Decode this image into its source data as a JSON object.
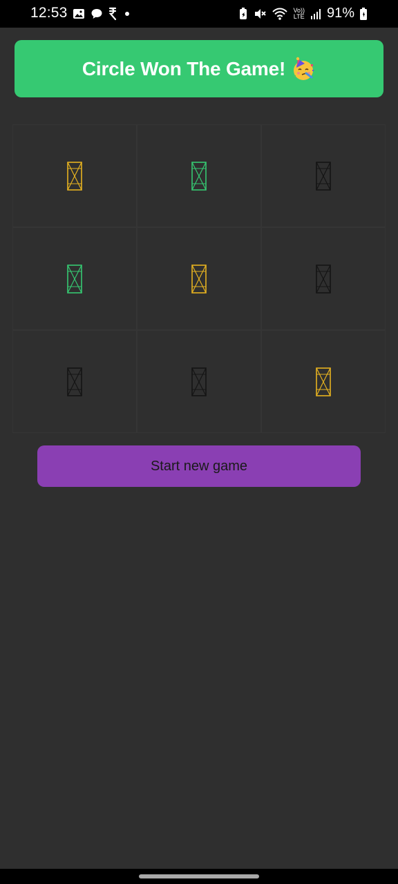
{
  "status_bar": {
    "time": "12:53",
    "battery_percent": "91%",
    "network_label_top": "Vo))",
    "network_label_bottom": "LTE",
    "left_icons": [
      "gallery-icon",
      "chat-bubble-icon",
      "rupee-icon",
      "dot-icon"
    ],
    "right_icons": [
      "battery-saver-icon",
      "mute-icon",
      "wifi-icon",
      "volte-icon",
      "signal-icon",
      "battery-icon"
    ]
  },
  "banner": {
    "text": "Circle Won The Game!",
    "emoji_icon": "party-face-icon",
    "color": "#36c972"
  },
  "board": {
    "cells": [
      {
        "mark": "broken-image-icon",
        "color": "#e7b320"
      },
      {
        "mark": "broken-image-icon",
        "color": "#36c972"
      },
      {
        "mark": "broken-image-icon",
        "color": "#141414"
      },
      {
        "mark": "broken-image-icon",
        "color": "#36c972"
      },
      {
        "mark": "broken-image-icon",
        "color": "#e7b320"
      },
      {
        "mark": "broken-image-icon",
        "color": "#141414"
      },
      {
        "mark": "broken-image-icon",
        "color": "#141414"
      },
      {
        "mark": "broken-image-icon",
        "color": "#141414"
      },
      {
        "mark": "broken-image-icon",
        "color": "#e7b320"
      }
    ]
  },
  "new_game_button": {
    "label": "Start new game",
    "color": "#8a3fb3"
  },
  "colors": {
    "background": "#2f2f2f",
    "status_bar": "#000000",
    "cell_border": "#353535"
  }
}
